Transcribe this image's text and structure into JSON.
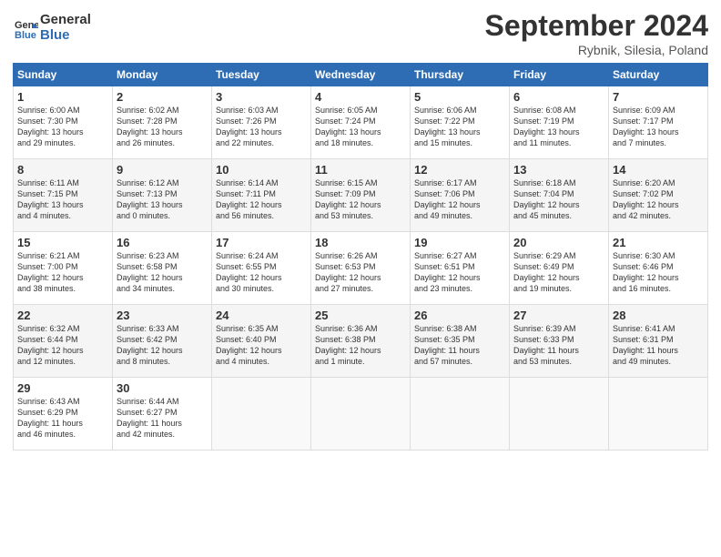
{
  "header": {
    "logo_line1": "General",
    "logo_line2": "Blue",
    "month_year": "September 2024",
    "location": "Rybnik, Silesia, Poland"
  },
  "days_of_week": [
    "Sunday",
    "Monday",
    "Tuesday",
    "Wednesday",
    "Thursday",
    "Friday",
    "Saturday"
  ],
  "weeks": [
    [
      {
        "day": "1",
        "info": "Sunrise: 6:00 AM\nSunset: 7:30 PM\nDaylight: 13 hours\nand 29 minutes."
      },
      {
        "day": "2",
        "info": "Sunrise: 6:02 AM\nSunset: 7:28 PM\nDaylight: 13 hours\nand 26 minutes."
      },
      {
        "day": "3",
        "info": "Sunrise: 6:03 AM\nSunset: 7:26 PM\nDaylight: 13 hours\nand 22 minutes."
      },
      {
        "day": "4",
        "info": "Sunrise: 6:05 AM\nSunset: 7:24 PM\nDaylight: 13 hours\nand 18 minutes."
      },
      {
        "day": "5",
        "info": "Sunrise: 6:06 AM\nSunset: 7:22 PM\nDaylight: 13 hours\nand 15 minutes."
      },
      {
        "day": "6",
        "info": "Sunrise: 6:08 AM\nSunset: 7:19 PM\nDaylight: 13 hours\nand 11 minutes."
      },
      {
        "day": "7",
        "info": "Sunrise: 6:09 AM\nSunset: 7:17 PM\nDaylight: 13 hours\nand 7 minutes."
      }
    ],
    [
      {
        "day": "8",
        "info": "Sunrise: 6:11 AM\nSunset: 7:15 PM\nDaylight: 13 hours\nand 4 minutes."
      },
      {
        "day": "9",
        "info": "Sunrise: 6:12 AM\nSunset: 7:13 PM\nDaylight: 13 hours\nand 0 minutes."
      },
      {
        "day": "10",
        "info": "Sunrise: 6:14 AM\nSunset: 7:11 PM\nDaylight: 12 hours\nand 56 minutes."
      },
      {
        "day": "11",
        "info": "Sunrise: 6:15 AM\nSunset: 7:09 PM\nDaylight: 12 hours\nand 53 minutes."
      },
      {
        "day": "12",
        "info": "Sunrise: 6:17 AM\nSunset: 7:06 PM\nDaylight: 12 hours\nand 49 minutes."
      },
      {
        "day": "13",
        "info": "Sunrise: 6:18 AM\nSunset: 7:04 PM\nDaylight: 12 hours\nand 45 minutes."
      },
      {
        "day": "14",
        "info": "Sunrise: 6:20 AM\nSunset: 7:02 PM\nDaylight: 12 hours\nand 42 minutes."
      }
    ],
    [
      {
        "day": "15",
        "info": "Sunrise: 6:21 AM\nSunset: 7:00 PM\nDaylight: 12 hours\nand 38 minutes."
      },
      {
        "day": "16",
        "info": "Sunrise: 6:23 AM\nSunset: 6:58 PM\nDaylight: 12 hours\nand 34 minutes."
      },
      {
        "day": "17",
        "info": "Sunrise: 6:24 AM\nSunset: 6:55 PM\nDaylight: 12 hours\nand 30 minutes."
      },
      {
        "day": "18",
        "info": "Sunrise: 6:26 AM\nSunset: 6:53 PM\nDaylight: 12 hours\nand 27 minutes."
      },
      {
        "day": "19",
        "info": "Sunrise: 6:27 AM\nSunset: 6:51 PM\nDaylight: 12 hours\nand 23 minutes."
      },
      {
        "day": "20",
        "info": "Sunrise: 6:29 AM\nSunset: 6:49 PM\nDaylight: 12 hours\nand 19 minutes."
      },
      {
        "day": "21",
        "info": "Sunrise: 6:30 AM\nSunset: 6:46 PM\nDaylight: 12 hours\nand 16 minutes."
      }
    ],
    [
      {
        "day": "22",
        "info": "Sunrise: 6:32 AM\nSunset: 6:44 PM\nDaylight: 12 hours\nand 12 minutes."
      },
      {
        "day": "23",
        "info": "Sunrise: 6:33 AM\nSunset: 6:42 PM\nDaylight: 12 hours\nand 8 minutes."
      },
      {
        "day": "24",
        "info": "Sunrise: 6:35 AM\nSunset: 6:40 PM\nDaylight: 12 hours\nand 4 minutes."
      },
      {
        "day": "25",
        "info": "Sunrise: 6:36 AM\nSunset: 6:38 PM\nDaylight: 12 hours\nand 1 minute."
      },
      {
        "day": "26",
        "info": "Sunrise: 6:38 AM\nSunset: 6:35 PM\nDaylight: 11 hours\nand 57 minutes."
      },
      {
        "day": "27",
        "info": "Sunrise: 6:39 AM\nSunset: 6:33 PM\nDaylight: 11 hours\nand 53 minutes."
      },
      {
        "day": "28",
        "info": "Sunrise: 6:41 AM\nSunset: 6:31 PM\nDaylight: 11 hours\nand 49 minutes."
      }
    ],
    [
      {
        "day": "29",
        "info": "Sunrise: 6:43 AM\nSunset: 6:29 PM\nDaylight: 11 hours\nand 46 minutes."
      },
      {
        "day": "30",
        "info": "Sunrise: 6:44 AM\nSunset: 6:27 PM\nDaylight: 11 hours\nand 42 minutes."
      },
      {
        "day": "",
        "info": ""
      },
      {
        "day": "",
        "info": ""
      },
      {
        "day": "",
        "info": ""
      },
      {
        "day": "",
        "info": ""
      },
      {
        "day": "",
        "info": ""
      }
    ]
  ]
}
